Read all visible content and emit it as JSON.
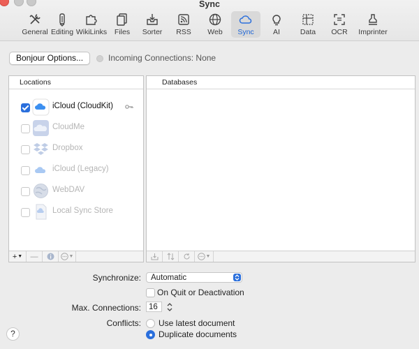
{
  "window": {
    "title": "Sync"
  },
  "toolbar": {
    "items": [
      {
        "label": "General",
        "icon": "wrench-screwdriver-icon"
      },
      {
        "label": "Editing",
        "icon": "pencil-icon"
      },
      {
        "label": "WikiLinks",
        "icon": "puzzle-icon"
      },
      {
        "label": "Files",
        "icon": "files-icon"
      },
      {
        "label": "Sorter",
        "icon": "sorter-tray-icon"
      },
      {
        "label": "RSS",
        "icon": "rss-icon"
      },
      {
        "label": "Web",
        "icon": "globe-icon"
      },
      {
        "label": "Sync",
        "icon": "cloud-icon",
        "selected": true
      },
      {
        "label": "AI",
        "icon": "lightbulb-icon"
      },
      {
        "label": "Data",
        "icon": "data-grid-icon"
      },
      {
        "label": "OCR",
        "icon": "ocr-scan-icon"
      },
      {
        "label": "Imprinter",
        "icon": "stamp-icon"
      }
    ]
  },
  "bonjour": {
    "button_label": "Bonjour Options...",
    "status_text": "Incoming Connections: None"
  },
  "locations": {
    "header": "Locations",
    "items": [
      {
        "label": "iCloud (CloudKit)",
        "checked": true,
        "enabled": true,
        "icon": "icloud-icon"
      },
      {
        "label": "CloudMe",
        "checked": false,
        "enabled": false,
        "icon": "cloudme-icon"
      },
      {
        "label": "Dropbox",
        "checked": false,
        "enabled": false,
        "icon": "dropbox-icon"
      },
      {
        "label": "iCloud (Legacy)",
        "checked": false,
        "enabled": false,
        "icon": "icloud-legacy-icon"
      },
      {
        "label": "WebDAV",
        "checked": false,
        "enabled": false,
        "icon": "webdav-globe-icon"
      },
      {
        "label": "Local Sync Store",
        "checked": false,
        "enabled": false,
        "icon": "local-store-icon"
      }
    ],
    "footer": {
      "add": "+",
      "remove": "—"
    }
  },
  "databases": {
    "header": "Databases"
  },
  "settings": {
    "synchronize_label": "Synchronize:",
    "synchronize_value": "Automatic",
    "quit_option_label": "On Quit or Deactivation",
    "max_connections_label": "Max. Connections:",
    "max_connections_value": "16",
    "conflicts_label": "Conflicts:",
    "conflict_options": [
      {
        "label": "Use latest document",
        "selected": false
      },
      {
        "label": "Duplicate documents",
        "selected": true
      }
    ]
  },
  "help": {
    "label": "?"
  },
  "colors": {
    "accent": "#2a6fdc",
    "close": "#ec5f57"
  }
}
